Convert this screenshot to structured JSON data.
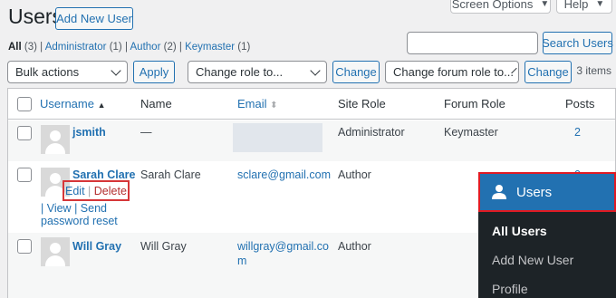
{
  "header": {
    "title": "Users",
    "add_new": "Add New User",
    "screen_options": "Screen Options",
    "help": "Help"
  },
  "filters": {
    "all": "All",
    "all_count": "(3)",
    "administrator": "Administrator",
    "administrator_count": "(1)",
    "author": "Author",
    "author_count": "(2)",
    "keymaster": "Keymaster",
    "keymaster_count": "(1)",
    "separator": "|"
  },
  "search": {
    "value": "",
    "button": "Search Users"
  },
  "bulk": {
    "actions_select": "Bulk actions",
    "apply": "Apply",
    "role_select": "Change role to...",
    "change": "Change",
    "forum_role_select": "Change forum role to...",
    "change2": "Change",
    "items_count": "3 items"
  },
  "table": {
    "columns": {
      "username": "Username",
      "name": "Name",
      "email": "Email",
      "site_role": "Site Role",
      "forum_role": "Forum Role",
      "posts": "Posts"
    },
    "rows": [
      {
        "username": "jsmith",
        "name": "—",
        "email": "",
        "site_role": "Administrator",
        "forum_role": "Keymaster",
        "posts": "2"
      },
      {
        "username": "Sarah Clare",
        "name": "Sarah Clare",
        "email": "sclare@gmail.com",
        "site_role": "Author",
        "forum_role": "",
        "posts": "0",
        "actions": {
          "edit": "Edit",
          "sep": "|",
          "delete": "Delete",
          "view": "| View",
          "send": "| Send",
          "reset": "password reset"
        }
      },
      {
        "username": "Will Gray",
        "name": "Will Gray",
        "email_line1": "willgray@gmail.co",
        "email_line2": "m",
        "site_role": "Author",
        "forum_role": "",
        "posts": ""
      }
    ]
  },
  "admin_menu": {
    "header": "Users",
    "items": [
      "All Users",
      "Add New User",
      "Profile"
    ]
  },
  "colors": {
    "accent": "#2271b1",
    "highlight": "#d63638",
    "menu_bg": "#1d2327"
  }
}
